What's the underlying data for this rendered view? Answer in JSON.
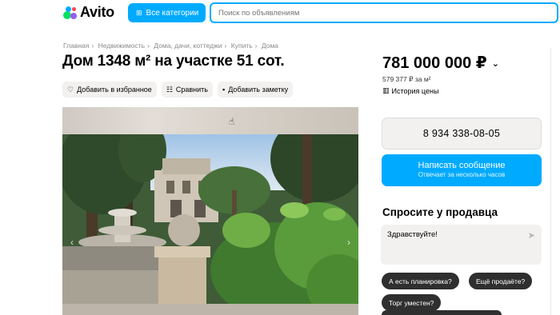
{
  "header": {
    "logo_text": "Avito",
    "categories_label": "Все категории",
    "search_placeholder": "Поиск по объявлениям"
  },
  "breadcrumb": [
    "Главная",
    "Недвижимость",
    "Дома, дачи, коттеджи",
    "Купить",
    "Дома"
  ],
  "title": "Дом 1348 м² на участке 51 сот.",
  "actions": {
    "favorite": "Добавить в избранное",
    "compare": "Сравнить",
    "note": "Добавить заметку"
  },
  "price": {
    "value": "781 000 000 ₽",
    "per_meter": "579 377 ₽ за м²",
    "history": "История цены"
  },
  "contact": {
    "phone": "8 934 338-08-05",
    "message_label": "Написать сообщение",
    "message_sub": "Отвечает за несколько часов"
  },
  "ask": {
    "title": "Спросите у продавца",
    "message": "Здравствуйте!",
    "chips": [
      "А есть планировка?",
      "Ещё продаёте?",
      "Торг уместен?"
    ]
  },
  "colors": {
    "accent": "#00aaff",
    "chip_bg": "#2f2f2f",
    "button_gray": "#f2f1f0"
  },
  "icons": {
    "heart": "heart-icon",
    "compare": "compare-icon",
    "note": "note-icon",
    "history": "chart-icon",
    "send": "send-icon",
    "search_categories": "grid-search-icon"
  }
}
